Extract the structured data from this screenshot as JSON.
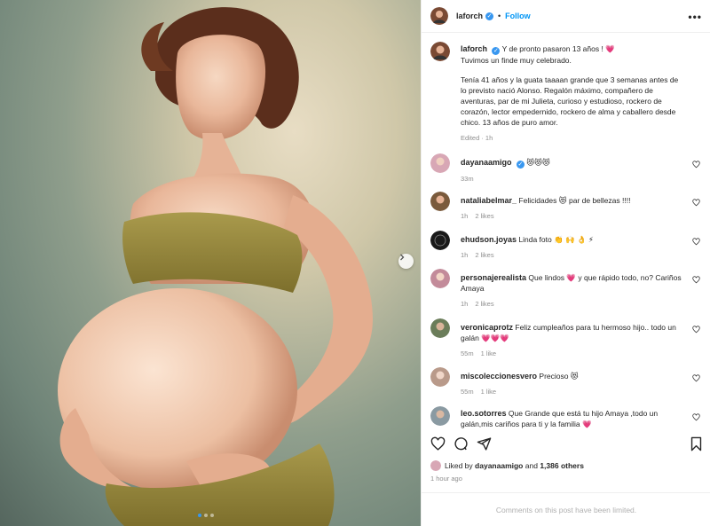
{
  "post": {
    "username": "laforch",
    "follow_label": "Follow",
    "bullet": "•",
    "more_label": "•••",
    "verified_mark": "✓"
  },
  "caption": {
    "username": "laforch",
    "line1": "Y de pronto pasaron 13 años ! 💗",
    "line2": "Tuvimos un finde muy celebrado.",
    "paragraph": "Tenía 41 años y la guata taaaan grande que 3 semanas antes de lo previsto nació Alonso. Regalón máximo, compañero de aventuras, par de mi Julieta, curioso y estudioso, rockero de corazón, lector empedernido, rockero de alma y caballero desde chico. 13 años de puro amor.",
    "meta": "Edited · 1h"
  },
  "comments": [
    {
      "username": "dayanaamigo",
      "text": "😻😻😻",
      "time": "33m",
      "likes": "",
      "avatar_color": "#d8a7b5"
    },
    {
      "username": "nataliabelmar_",
      "text": "Felicidades 😻 par de bellezas !!!!",
      "time": "1h",
      "likes": "2 likes",
      "avatar_color": "#7a5a3c"
    },
    {
      "username": "ehudson.joyas",
      "text": "Linda foto 👏 🙌 👌 ⚡",
      "time": "1h",
      "likes": "2 likes",
      "avatar_color": "#1a1a1a"
    },
    {
      "username": "personajerealista",
      "text": "Que lindos 💗 y que rápido todo, no? Cariños Amaya",
      "time": "1h",
      "likes": "2 likes",
      "avatar_color": "#c38b9a"
    },
    {
      "username": "veronicaprotz",
      "text": "Feliz cumpleaños para tu hermoso hijo.. todo un galán 💗💗💗",
      "time": "55m",
      "likes": "1 like",
      "avatar_color": "#6b7d5a"
    },
    {
      "username": "miscoleccionesvero",
      "text": "Precioso 😻",
      "time": "55m",
      "likes": "1 like",
      "avatar_color": "#b99a8a"
    },
    {
      "username": "leo.sotorres",
      "text": "Que Grande que está tu hijo Amaya ,todo un galán,mis cariños para ti y la familia 💗",
      "time": "",
      "likes": "",
      "avatar_color": "#8a9aa2"
    }
  ],
  "likes": {
    "prefix": "Liked by",
    "user": "dayanaamigo",
    "and": "and",
    "others": "1,386 others"
  },
  "time_ago": "1 hour ago",
  "limited_notice": "Comments on this post have been limited.",
  "icons": {
    "heart": "heart-icon",
    "comment": "comment-icon",
    "share": "share-icon",
    "save": "bookmark-icon",
    "next": "chevron-right-icon"
  },
  "colors": {
    "accent": "#0095f6",
    "verified": "#3897f0",
    "muted": "#8e8e8e"
  }
}
